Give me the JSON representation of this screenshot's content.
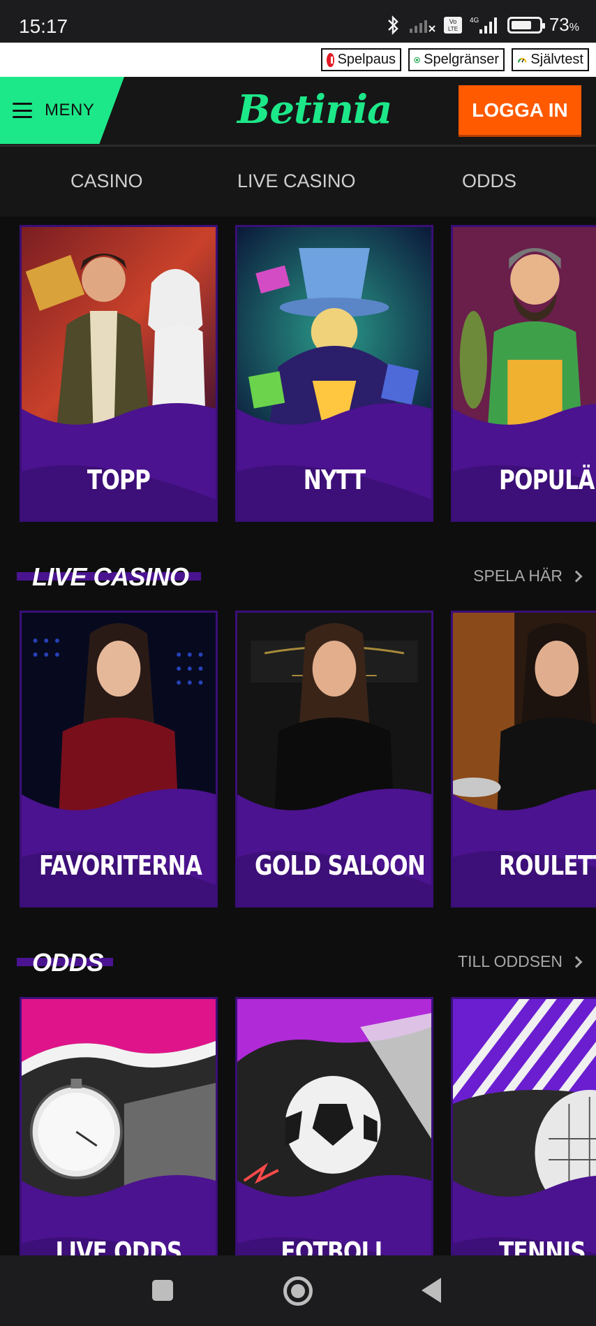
{
  "status_bar": {
    "time": "15:17",
    "battery_percent": "73",
    "battery_unit": "%",
    "battery_level": 0.73,
    "network": "4G",
    "volte": "Vo LTE",
    "icons": [
      "bluetooth-icon",
      "signal-icon",
      "volte-icon",
      "signal-4g-icon",
      "battery-icon"
    ]
  },
  "rg_bar": {
    "spelpaus": "Spelpaus",
    "spelgranser": "Spelgränser",
    "sjalvtest": "Självtest"
  },
  "header": {
    "menu_label": "MENY",
    "logo_text": "Betinia",
    "login_label": "LOGGA IN",
    "colors": {
      "accent": "#1de889",
      "login": "#ff5a00",
      "card": "#2a0b5e"
    }
  },
  "nav_tabs": [
    "CASINO",
    "LIVE CASINO",
    "ODDS"
  ],
  "casino_cards": [
    {
      "title": "TOPP"
    },
    {
      "title": "NYTT"
    },
    {
      "title": "POPULÄRT"
    }
  ],
  "live_casino": {
    "title": "LIVE CASINO",
    "link": "SPELA HÄR",
    "cards": [
      {
        "title": "FAVORITERNA"
      },
      {
        "title": "GOLD SALOON"
      },
      {
        "title": "ROULETTE"
      }
    ]
  },
  "odds": {
    "title": "ODDS",
    "link": "TILL ODDSEN",
    "cards": [
      {
        "title": "LIVE ODDS"
      },
      {
        "title": "FOTBOLL"
      },
      {
        "title": "TENNIS"
      }
    ]
  },
  "bottom_nav": [
    "recents-square-icon",
    "home-circle-icon",
    "back-triangle-icon"
  ]
}
